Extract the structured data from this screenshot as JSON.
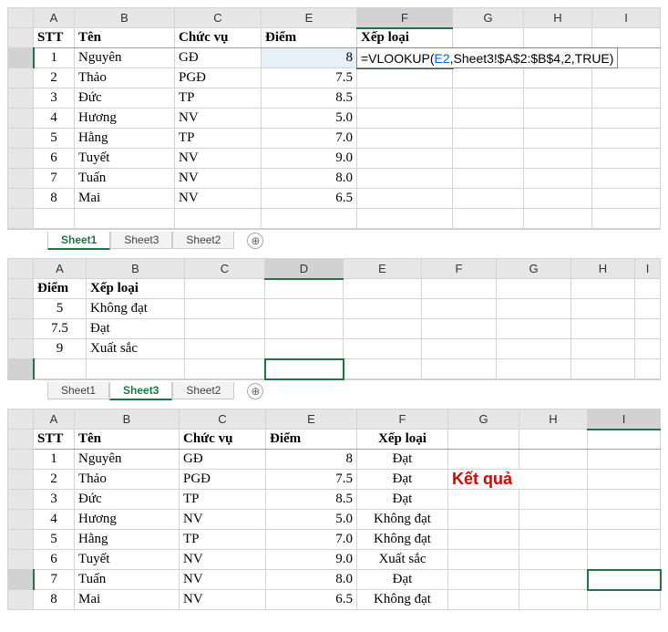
{
  "pane1": {
    "col_headers": [
      "A",
      "B",
      "C",
      "E",
      "F",
      "G",
      "H",
      "I"
    ],
    "header_row": {
      "stt": "STT",
      "ten": "Tên",
      "chucvu": "Chức vụ",
      "diem": "Điểm",
      "xeploai": "Xếp loại"
    },
    "rows": [
      {
        "stt": "1",
        "ten": "Nguyên",
        "chucvu": "GĐ",
        "diem": "8"
      },
      {
        "stt": "2",
        "ten": "Thảo",
        "chucvu": "PGĐ",
        "diem": "7.5"
      },
      {
        "stt": "3",
        "ten": "Đức",
        "chucvu": "TP",
        "diem": "8.5"
      },
      {
        "stt": "4",
        "ten": "Hương",
        "chucvu": "NV",
        "diem": "5.0"
      },
      {
        "stt": "5",
        "ten": "Hằng",
        "chucvu": "TP",
        "diem": "7.0"
      },
      {
        "stt": "6",
        "ten": "Tuyết",
        "chucvu": "NV",
        "diem": "9.0"
      },
      {
        "stt": "7",
        "ten": "Tuấn",
        "chucvu": "NV",
        "diem": "8.0"
      },
      {
        "stt": "8",
        "ten": "Mai",
        "chucvu": "NV",
        "diem": "6.5"
      }
    ],
    "formula_prefix": "=VLOOKUP(",
    "formula_ref": "E2",
    "formula_suffix": ",Sheet3!$A$2:$B$4,2,TRUE)",
    "tabs": [
      "Sheet1",
      "Sheet3",
      "Sheet2"
    ],
    "active_tab": 0
  },
  "pane2": {
    "col_headers": [
      "A",
      "B",
      "C",
      "D",
      "E",
      "F",
      "G",
      "H",
      "I"
    ],
    "header_row": {
      "diem": "Điểm",
      "xeploai": "Xếp loại"
    },
    "rows": [
      {
        "diem": "5",
        "xeploai": "Không đạt"
      },
      {
        "diem": "7.5",
        "xeploai": "Đạt"
      },
      {
        "diem": "9",
        "xeploai": "Xuất sắc"
      }
    ],
    "tabs": [
      "Sheet1",
      "Sheet3",
      "Sheet2"
    ],
    "active_tab": 1
  },
  "pane3": {
    "col_headers": [
      "A",
      "B",
      "C",
      "E",
      "F",
      "G",
      "H",
      "I"
    ],
    "header_row": {
      "stt": "STT",
      "ten": "Tên",
      "chucvu": "Chức vụ",
      "diem": "Điểm",
      "xeploai": "Xếp loại"
    },
    "rows": [
      {
        "stt": "1",
        "ten": "Nguyên",
        "chucvu": "GĐ",
        "diem": "8",
        "xeploai": "Đạt"
      },
      {
        "stt": "2",
        "ten": "Thảo",
        "chucvu": "PGĐ",
        "diem": "7.5",
        "xeploai": "Đạt"
      },
      {
        "stt": "3",
        "ten": "Đức",
        "chucvu": "TP",
        "diem": "8.5",
        "xeploai": "Đạt"
      },
      {
        "stt": "4",
        "ten": "Hương",
        "chucvu": "NV",
        "diem": "5.0",
        "xeploai": "Không đạt"
      },
      {
        "stt": "5",
        "ten": "Hằng",
        "chucvu": "TP",
        "diem": "7.0",
        "xeploai": "Không đạt"
      },
      {
        "stt": "6",
        "ten": "Tuyết",
        "chucvu": "NV",
        "diem": "9.0",
        "xeploai": "Xuất sắc"
      },
      {
        "stt": "7",
        "ten": "Tuấn",
        "chucvu": "NV",
        "diem": "8.0",
        "xeploai": "Đạt"
      },
      {
        "stt": "8",
        "ten": "Mai",
        "chucvu": "NV",
        "diem": "6.5",
        "xeploai": "Không đạt"
      }
    ],
    "callout": "Kết quả"
  },
  "icons": {
    "plus": "⊕"
  }
}
